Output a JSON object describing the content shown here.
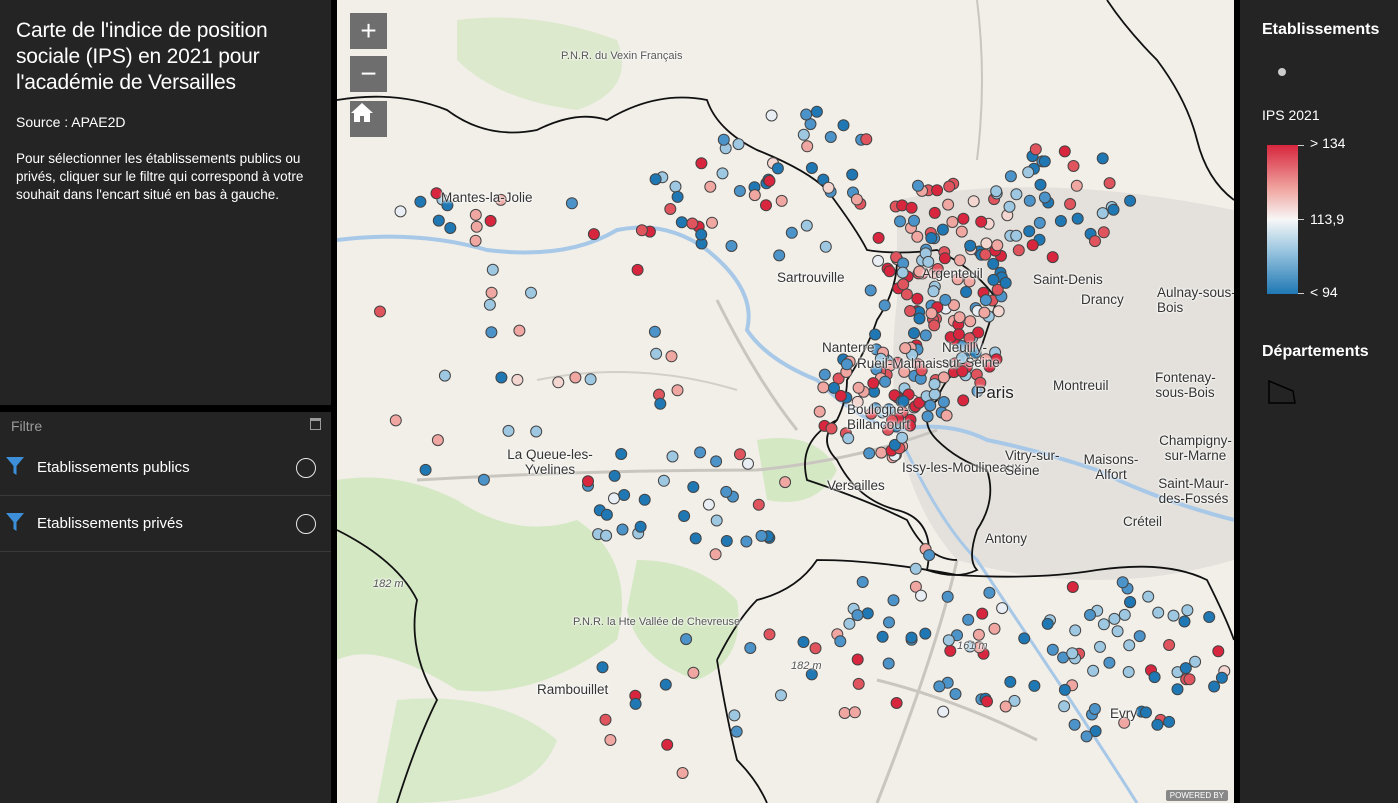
{
  "info": {
    "title": "Carte de l'indice de position sociale (IPS) en 2021 pour l'académie de Versailles",
    "source": "Source : APAE2D",
    "description": "Pour sélectionner les établissements publics ou privés, cliquer sur le filtre qui correspond à votre souhait dans l'encart situé en bas à gauche."
  },
  "filter": {
    "header": "Filtre",
    "items": [
      {
        "label": "Etablissements publics",
        "icon": "funnel-icon",
        "selected": false
      },
      {
        "label": "Etablissements privés",
        "icon": "funnel-icon",
        "selected": false
      }
    ]
  },
  "map": {
    "zoom_in": "+",
    "zoom_out": "−",
    "home": "home-icon",
    "labels": {
      "mantes": "Mantes-la-Jolie",
      "sartrouville": "Sartrouville",
      "argenteuil": "Argenteuil",
      "saint_denis": "Saint-Denis",
      "drancy": "Drancy",
      "aulnay": "Aulnay-sous-Bois",
      "nanterre": "Nanterre",
      "rueil": "Rueil-Malmaison",
      "neuilly": "Neuilly-sur-Seine",
      "paris": "Paris",
      "montreuil": "Montreuil",
      "fontenay": "Fontenay-sous-Bois",
      "boulogne": "Boulogne-Billancourt",
      "queue": "La Queue-les-Yvelines",
      "versailles": "Versailles",
      "moulineaux": "Issy-les-Moulineaux",
      "vitry": "Vitry-sur-Seine",
      "maisons": "Maisons-Alfort",
      "champigny": "Champigny-sur-Marne",
      "saint_maur": "Saint-Maur-des-Fossés",
      "creteil": "Créteil",
      "antony": "Antony",
      "rambouillet": "Rambouillet",
      "evry": "Evry",
      "pnr_vexin": "P.N.R. du Vexin Français",
      "pnr_chevreuse": "P.N.R. la Hte Vallée de Chevreuse",
      "elev1": "182 m",
      "elev2": "182 m",
      "elev3": "161 m"
    },
    "attribution": "POWERED BY",
    "colors": {
      "high": "#d7263d",
      "mid": "#f7f7f7",
      "low": "#1f78b4"
    }
  },
  "legend": {
    "etab_title": "Etablissements",
    "ips_title": "IPS 2021",
    "ips_max": "> 134",
    "ips_mid": "113,9",
    "ips_min": "< 94",
    "dept_title": "Départements"
  }
}
